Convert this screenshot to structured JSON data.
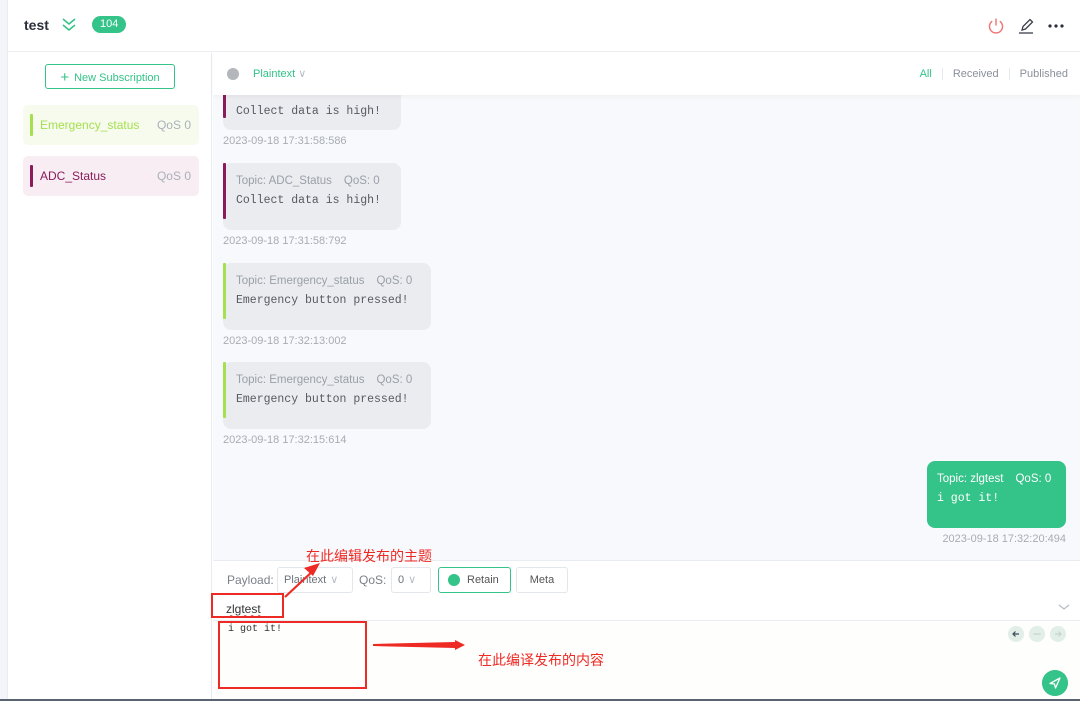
{
  "header": {
    "connection_name": "test",
    "message_count": "104",
    "icons": [
      "power-icon",
      "edit-icon",
      "more-icon"
    ]
  },
  "sidebar": {
    "new_subscription_label": "New Subscription",
    "subscriptions": [
      {
        "topic": "Emergency_status",
        "qos": "QoS 0",
        "color": "#a5e050"
      },
      {
        "topic": "ADC_Status",
        "qos": "QoS 0",
        "color": "#8a1c5c"
      }
    ]
  },
  "toolbar": {
    "payload_type": "Plaintext",
    "filters": [
      "All",
      "Received",
      "Published"
    ],
    "active_filter": "All"
  },
  "messages": [
    {
      "direction": "received",
      "topic": "",
      "qos": "",
      "payload": "Collect data is high!",
      "time": "2023-09-18 17:31:58:586",
      "color": "#8a1c5c"
    },
    {
      "direction": "received",
      "topic": "Topic: ADC_Status",
      "qos": "QoS: 0",
      "payload": "Collect data is high!",
      "time": "2023-09-18 17:31:58:792",
      "color": "#8a1c5c"
    },
    {
      "direction": "received",
      "topic": "Topic: Emergency_status",
      "qos": "QoS: 0",
      "payload": "Emergency button pressed!",
      "time": "2023-09-18 17:32:13:002",
      "color": "#a5e050"
    },
    {
      "direction": "received",
      "topic": "Topic: Emergency_status",
      "qos": "QoS: 0",
      "payload": "Emergency button pressed!",
      "time": "2023-09-18 17:32:15:614",
      "color": "#a5e050"
    },
    {
      "direction": "published",
      "topic": "Topic: zlgtest",
      "qos": "QoS: 0",
      "payload": "i got it!",
      "time": "2023-09-18 17:32:20:494",
      "color": "#34c388"
    }
  ],
  "publish": {
    "payload_label": "Payload:",
    "payload_format": "Plaintext",
    "qos_label": "QoS:",
    "qos_value": "0",
    "retain_label": "Retain",
    "meta_label": "Meta",
    "topic_value": "zlgtest",
    "payload_value": "i got it!"
  },
  "annotations": {
    "topic_note": "在此编辑发布的主题",
    "payload_note": "在此编译发布的内容",
    "color": "#ee2a24"
  },
  "colors": {
    "accent": "#34c388",
    "power": "#f07070"
  }
}
